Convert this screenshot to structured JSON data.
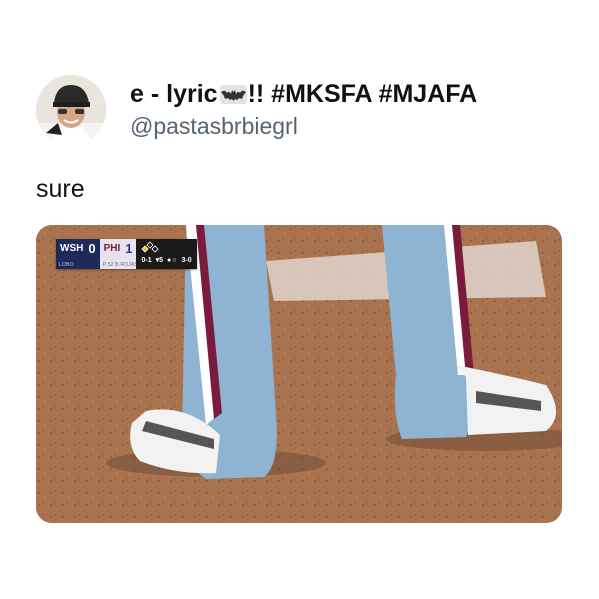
{
  "tweet": {
    "display_name_prefix": "e - lyric",
    "display_name_suffix": "!! #MKSFA #MJAFA",
    "handle": "@pastasbrbiegrl",
    "text": "sure"
  },
  "scorebug": {
    "away_team": "WSH",
    "away_score": "0",
    "away_sub": "LOBO",
    "home_team": "PHI",
    "home_score": "1",
    "home_sub": "P:52  B.ROJAS",
    "home_sub2": "0-1",
    "inning": "▾5",
    "outs": "●○",
    "count": "3-0"
  },
  "icons": {
    "bat": "bat-emoji-icon",
    "avatar": "profile-avatar"
  },
  "colors": {
    "text": "#111111",
    "handle": "#566370",
    "uniform_blue": "#8fb3d3",
    "pinstripe": "#7a1b3e",
    "dirt": "#a9734f"
  }
}
